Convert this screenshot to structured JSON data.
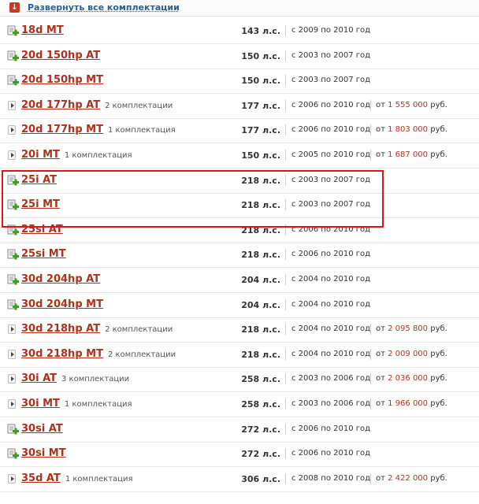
{
  "expand_all_label": "Развернуть все комплектации",
  "hp_unit": "л.с.",
  "price_prefix": "от",
  "price_suffix": "руб.",
  "colors": {
    "link": "#b0301c",
    "price": "#c0301c",
    "highlight": "#e0121b",
    "plus_icon": "#3f9e2a"
  },
  "rows": [
    {
      "name": "18d MT",
      "icon": "add-complectation-icon",
      "count": "",
      "hp": "143",
      "years": "с 2009 по 2010 год",
      "price": ""
    },
    {
      "name": "20d 150hp AT",
      "icon": "add-complectation-icon",
      "count": "",
      "hp": "150",
      "years": "с 2003 по 2007 год",
      "price": ""
    },
    {
      "name": "20d 150hp MT",
      "icon": "add-complectation-icon",
      "count": "",
      "hp": "150",
      "years": "с 2003 по 2007 год",
      "price": ""
    },
    {
      "name": "20d 177hp AT",
      "icon": "expand-arrow-icon",
      "count": "2 комплектации",
      "hp": "177",
      "years": "с 2006 по 2010 год",
      "price": "1 555 000"
    },
    {
      "name": "20d 177hp MT",
      "icon": "expand-arrow-icon",
      "count": "1 комплектация",
      "hp": "177",
      "years": "с 2006 по 2010 год",
      "price": "1 803 000"
    },
    {
      "name": "20i MT",
      "icon": "expand-arrow-icon",
      "count": "1 комплектация",
      "hp": "150",
      "years": "с 2005 по 2010 год",
      "price": "1 687 000"
    },
    {
      "name": "25i AT",
      "icon": "add-complectation-icon",
      "count": "",
      "hp": "218",
      "years": "с 2003 по 2007 год",
      "price": ""
    },
    {
      "name": "25i MT",
      "icon": "add-complectation-icon",
      "count": "",
      "hp": "218",
      "years": "с 2003 по 2007 год",
      "price": ""
    },
    {
      "name": "25si AT",
      "icon": "add-complectation-icon",
      "count": "",
      "hp": "218",
      "years": "с 2006 по 2010 год",
      "price": ""
    },
    {
      "name": "25si MT",
      "icon": "add-complectation-icon",
      "count": "",
      "hp": "218",
      "years": "с 2006 по 2010 год",
      "price": ""
    },
    {
      "name": "30d 204hp AT",
      "icon": "add-complectation-icon",
      "count": "",
      "hp": "204",
      "years": "с 2004 по 2010 год",
      "price": ""
    },
    {
      "name": "30d 204hp MT",
      "icon": "add-complectation-icon",
      "count": "",
      "hp": "204",
      "years": "с 2004 по 2010 год",
      "price": ""
    },
    {
      "name": "30d 218hp AT",
      "icon": "expand-arrow-icon",
      "count": "2 комплектации",
      "hp": "218",
      "years": "с 2004 по 2010 год",
      "price": "2 095 800"
    },
    {
      "name": "30d 218hp MT",
      "icon": "expand-arrow-icon",
      "count": "2 комплектации",
      "hp": "218",
      "years": "с 2004 по 2010 год",
      "price": "2 009 000"
    },
    {
      "name": "30i AT",
      "icon": "expand-arrow-icon",
      "count": "3 комплектации",
      "hp": "258",
      "years": "с 2003 по 2006 год",
      "price": "2 036 000"
    },
    {
      "name": "30i MT",
      "icon": "expand-arrow-icon",
      "count": "1 комплектация",
      "hp": "258",
      "years": "с 2003 по 2006 год",
      "price": "1 966 000"
    },
    {
      "name": "30si AT",
      "icon": "add-complectation-icon",
      "count": "",
      "hp": "272",
      "years": "с 2006 по 2010 год",
      "price": ""
    },
    {
      "name": "30si MT",
      "icon": "add-complectation-icon",
      "count": "",
      "hp": "272",
      "years": "с 2006 по 2010 год",
      "price": ""
    },
    {
      "name": "35d AT",
      "icon": "expand-arrow-icon",
      "count": "1 комплектация",
      "hp": "306",
      "years": "с 2008 по 2010 год",
      "price": "2 422 000"
    }
  ]
}
